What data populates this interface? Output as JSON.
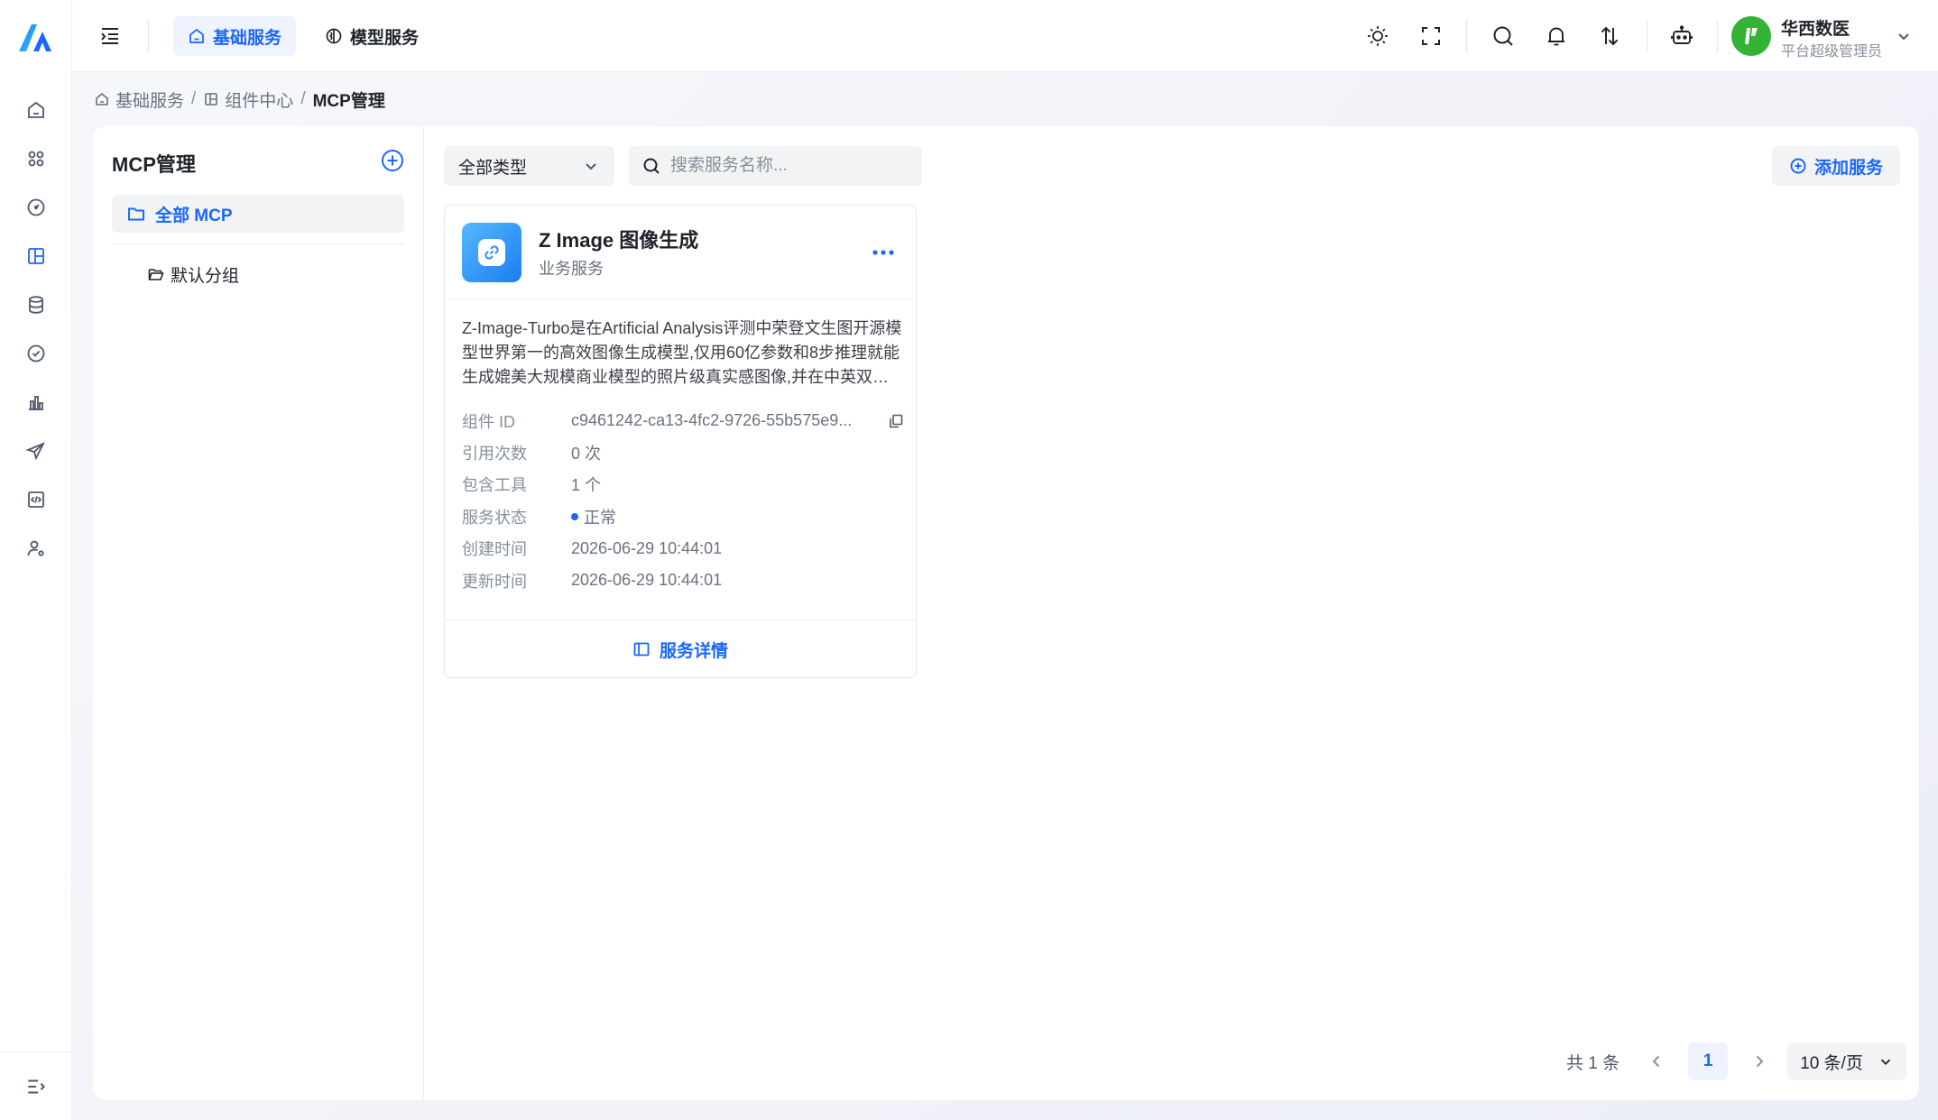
{
  "top_nav": {
    "tabs": [
      {
        "label": "基础服务",
        "active": true
      },
      {
        "label": "模型服务",
        "active": false
      }
    ]
  },
  "user": {
    "name": "华西数医",
    "role": "平台超级管理员"
  },
  "sidebar": {
    "items": [
      {
        "icon": "home-icon"
      },
      {
        "icon": "apps-icon"
      },
      {
        "icon": "dashboard-icon"
      },
      {
        "icon": "components-icon",
        "active": true
      },
      {
        "icon": "database-icon"
      },
      {
        "icon": "check-circle-icon"
      },
      {
        "icon": "bar-chart-icon"
      },
      {
        "icon": "send-icon"
      },
      {
        "icon": "code-icon"
      },
      {
        "icon": "user-settings-icon"
      }
    ]
  },
  "breadcrumb": {
    "items": [
      "基础服务",
      "组件中心"
    ],
    "current": "MCP管理"
  },
  "left_panel": {
    "title": "MCP管理",
    "all_label": "全部 MCP",
    "groups": [
      "默认分组"
    ]
  },
  "toolbar": {
    "type_filter": "全部类型",
    "search_placeholder": "搜索服务名称...",
    "add_label": "添加服务"
  },
  "service_card": {
    "name": "Z Image 图像生成",
    "type": "业务服务",
    "description": "Z-Image-Turbo是在Artificial Analysis评测中荣登文生图开源模型世界第一的高效图像生成模型,仅用60亿参数和8步推理就能生成媲美大规模商业模型的照片级真实感图像,并在中英双语文字渲染方面表现出色。",
    "fields": [
      {
        "key": "组件 ID",
        "value": "c9461242-ca13-4fc2-9726-55b575e9..."
      },
      {
        "key": "引用次数",
        "value": "0 次"
      },
      {
        "key": "包含工具",
        "value": "1 个"
      },
      {
        "key": "服务状态",
        "value": "正常"
      },
      {
        "key": "创建时间",
        "value": "2026-06-29 10:44:01"
      },
      {
        "key": "更新时间",
        "value": "2026-06-29 10:44:01"
      }
    ],
    "detail_label": "服务详情",
    "status_color": "#1a66ff"
  },
  "pagination": {
    "total": "共 1 条",
    "current_page": "1",
    "page_size": "10 条/页"
  },
  "colors": {
    "accent": "#1a66ff",
    "avatar": "#34b233"
  }
}
